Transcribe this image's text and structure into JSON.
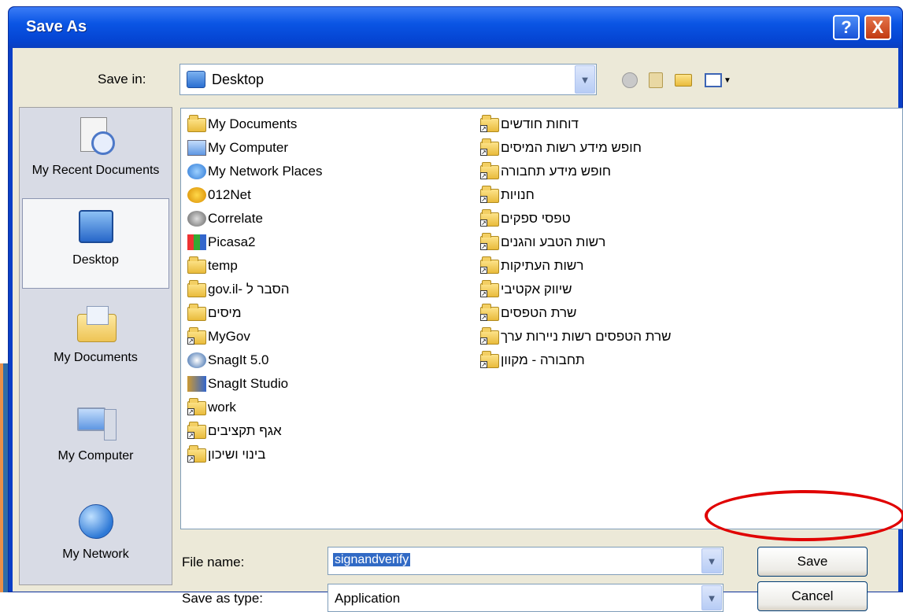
{
  "dialog": {
    "title": "Save As"
  },
  "titlebar_buttons": {
    "help": "?",
    "close": "X"
  },
  "save_in": {
    "label": "Save in:",
    "value": "Desktop"
  },
  "toolbar_icons": [
    "back-icon",
    "up-folder-icon",
    "new-folder-icon",
    "views-menu-icon"
  ],
  "places": [
    {
      "label": "My Recent Documents",
      "icon": "recent-documents-icon"
    },
    {
      "label": "Desktop",
      "icon": "desktop-icon"
    },
    {
      "label": "My Documents",
      "icon": "my-documents-icon"
    },
    {
      "label": "My Computer",
      "icon": "my-computer-icon"
    },
    {
      "label": "My Network",
      "icon": "my-network-icon"
    }
  ],
  "files_left": [
    {
      "name": "My Documents",
      "icon": "my-documents-icon"
    },
    {
      "name": "My Computer",
      "icon": "my-computer-icon"
    },
    {
      "name": "My Network Places",
      "icon": "network-places-icon"
    },
    {
      "name": "012Net",
      "icon": "app-012net-icon"
    },
    {
      "name": "Correlate",
      "icon": "app-correlate-icon"
    },
    {
      "name": "Picasa2",
      "icon": "app-picasa-icon"
    },
    {
      "name": "temp",
      "icon": "folder-icon"
    },
    {
      "name": "gov.il- הסבר ל",
      "icon": "folder-icon"
    },
    {
      "name": "מיסים",
      "icon": "folder-icon"
    },
    {
      "name": "MyGov",
      "icon": "shortcut-folder-icon"
    },
    {
      "name": "SnagIt 5.0",
      "icon": "app-snagit-icon"
    },
    {
      "name": "SnagIt Studio",
      "icon": "app-snagit-studio-icon"
    },
    {
      "name": "work",
      "icon": "shortcut-folder-icon"
    },
    {
      "name": "אגף תקציבים",
      "icon": "shortcut-folder-icon"
    },
    {
      "name": "בינוי ושיכון",
      "icon": "shortcut-folder-icon"
    }
  ],
  "files_right": [
    {
      "name": "דוחות חודשים",
      "icon": "shortcut-folder-icon"
    },
    {
      "name": "חופש מידע רשות המיסים",
      "icon": "shortcut-folder-icon"
    },
    {
      "name": "חופש מידע תחבורה",
      "icon": "shortcut-folder-icon"
    },
    {
      "name": "חנויות",
      "icon": "shortcut-folder-icon"
    },
    {
      "name": "טפסי ספקים",
      "icon": "shortcut-folder-icon"
    },
    {
      "name": "רשות הטבע והגנים",
      "icon": "shortcut-folder-icon"
    },
    {
      "name": "רשות העתיקות",
      "icon": "shortcut-folder-icon"
    },
    {
      "name": "שיווק אקטיבי",
      "icon": "shortcut-folder-icon"
    },
    {
      "name": "שרת הטפסים",
      "icon": "shortcut-folder-icon"
    },
    {
      "name": "שרת הטפסים רשות ניירות ערך",
      "icon": "shortcut-folder-icon"
    },
    {
      "name": "תחבורה - מקוון",
      "icon": "shortcut-folder-icon"
    }
  ],
  "file_name": {
    "label": "File name:",
    "value": "signandverify"
  },
  "save_as_type": {
    "label": "Save as type:",
    "value": "Application"
  },
  "buttons": {
    "save": "Save",
    "cancel": "Cancel"
  },
  "colors": {
    "titlebar": "#0a55e4",
    "dialog_bg": "#ece9d8",
    "highlight": "#e00000"
  }
}
